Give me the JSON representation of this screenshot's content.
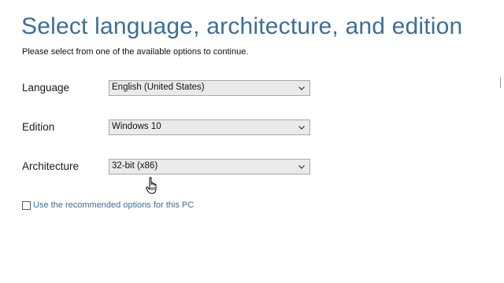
{
  "header": {
    "title": "Select language, architecture, and edition",
    "subtitle": "Please select from one of the available options to continue."
  },
  "form": {
    "language": {
      "label": "Language",
      "value": "English (United States)",
      "icon": "chevron-down-icon"
    },
    "edition": {
      "label": "Edition",
      "value": "Windows 10",
      "icon": "chevron-down-icon"
    },
    "architecture": {
      "label": "Architecture",
      "value": "32-bit (x86)",
      "icon": "chevron-down-icon"
    },
    "recommended": {
      "label": "Use the recommended options for this PC",
      "checked": false
    }
  },
  "colors": {
    "title": "#3c6f98",
    "select_background": "#eaeaea",
    "select_border": "#a8a8a8"
  },
  "cursor": {
    "icon": "hand-pointer-icon"
  }
}
